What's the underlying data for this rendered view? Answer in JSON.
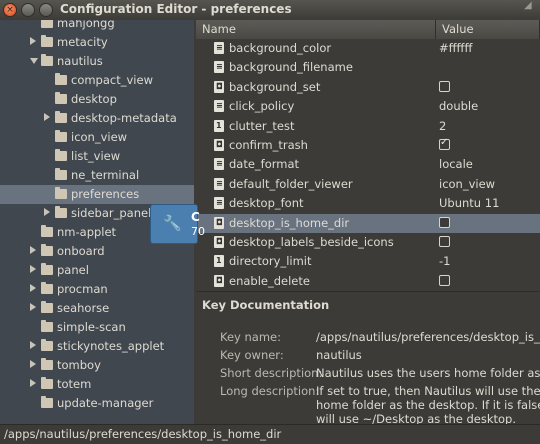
{
  "window": {
    "title": "Configuration Editor - preferences"
  },
  "tree": [
    {
      "label": "mahjongg",
      "expander": "none"
    },
    {
      "label": "metacity",
      "expander": "right"
    },
    {
      "label": "nautilus",
      "expander": "down"
    },
    {
      "label": "compact_view",
      "expander": "none",
      "child": true
    },
    {
      "label": "desktop",
      "expander": "none",
      "child": true
    },
    {
      "label": "desktop-metadata",
      "expander": "right",
      "child": true
    },
    {
      "label": "icon_view",
      "expander": "none",
      "child": true
    },
    {
      "label": "list_view",
      "expander": "none",
      "child": true
    },
    {
      "label": "ne_terminal",
      "expander": "none",
      "child": true
    },
    {
      "label": "preferences",
      "expander": "none",
      "child": true,
      "selected": true
    },
    {
      "label": "sidebar_panels",
      "expander": "right",
      "child": true
    },
    {
      "label": "nm-applet",
      "expander": "none"
    },
    {
      "label": "onboard",
      "expander": "right"
    },
    {
      "label": "panel",
      "expander": "right"
    },
    {
      "label": "procman",
      "expander": "right"
    },
    {
      "label": "seahorse",
      "expander": "right"
    },
    {
      "label": "simple-scan",
      "expander": "none"
    },
    {
      "label": "stickynotes_applet",
      "expander": "right"
    },
    {
      "label": "tomboy",
      "expander": "right"
    },
    {
      "label": "totem",
      "expander": "right"
    },
    {
      "label": "update-manager",
      "expander": "none"
    }
  ],
  "overlay": {
    "line1": "C",
    "line2": "70"
  },
  "columns": {
    "name": "Name",
    "value": "Value"
  },
  "keys": [
    {
      "name": "background_color",
      "type": "S",
      "value": "#ffffff"
    },
    {
      "name": "background_filename",
      "type": "S",
      "value": ""
    },
    {
      "name": "background_set",
      "type": "B",
      "checked": false
    },
    {
      "name": "click_policy",
      "type": "S",
      "value": "double"
    },
    {
      "name": "clutter_test",
      "type": "1",
      "value": "2"
    },
    {
      "name": "confirm_trash",
      "type": "B",
      "checked": true
    },
    {
      "name": "date_format",
      "type": "S",
      "value": "locale"
    },
    {
      "name": "default_folder_viewer",
      "type": "S",
      "value": "icon_view"
    },
    {
      "name": "desktop_font",
      "type": "S",
      "value": "Ubuntu 11"
    },
    {
      "name": "desktop_is_home_dir",
      "type": "B",
      "checked": false,
      "selected": true
    },
    {
      "name": "desktop_labels_beside_icons",
      "type": "B",
      "checked": false
    },
    {
      "name": "directory_limit",
      "type": "1",
      "value": "-1"
    },
    {
      "name": "enable_delete",
      "type": "B",
      "checked": false
    }
  ],
  "doc": {
    "title": "Key Documentation",
    "key_name_label": "Key name:",
    "key_name": "/apps/nautilus/preferences/desktop_is_home_dir",
    "key_owner_label": "Key owner:",
    "key_owner": "nautilus",
    "short_label": "Short description:",
    "short_desc": "Nautilus uses the users home folder as the desktop",
    "long_label": "Long description:",
    "long_line1": "If set to true, then Nautilus will use the user's",
    "long_line2": "home folder as the desktop. If it is false, then it",
    "long_line3": "will use ~/Desktop as the desktop."
  },
  "status": {
    "path": "/apps/nautilus/preferences/desktop_is_home_dir"
  }
}
